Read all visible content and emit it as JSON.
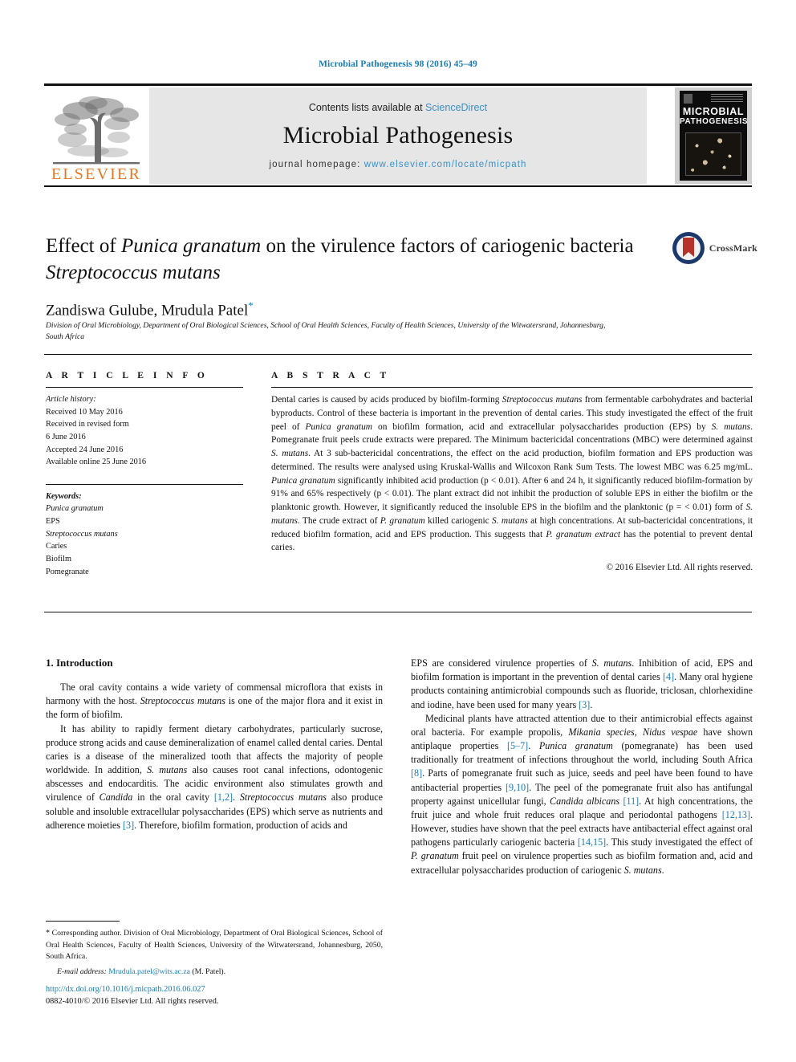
{
  "running_head": "Microbial Pathogenesis 98 (2016) 45–49",
  "masthead": {
    "publisher_name": "ELSEVIER",
    "contents_prefix": "Contents lists available at ",
    "contents_link": "ScienceDirect",
    "journal_name": "Microbial Pathogenesis",
    "homepage_prefix": "journal homepage: ",
    "homepage_url": "www.elsevier.com/locate/micpath",
    "cover_title_line1": "MICROBIAL",
    "cover_title_line2": "PATHOGENESIS"
  },
  "article": {
    "title_part1": "Effect of ",
    "title_italic1": "Punica granatum",
    "title_part2": " on the virulence factors of cariogenic bacteria ",
    "title_italic2": "Streptococcus mutans",
    "authors": "Zandiswa Gulube, Mrudula Patel",
    "corresponding_marker": "*",
    "affiliation": "Division of Oral Microbiology, Department of Oral Biological Sciences, School of Oral Health Sciences, Faculty of Health Sciences, University of the Witwatersrand, Johannesburg, South Africa",
    "crossmark_label": "CrossMark"
  },
  "article_info": {
    "heading": "A R T I C L E   I N F O",
    "history_label": "Article history:",
    "history": [
      "Received 10 May 2016",
      "Received in revised form",
      "6 June 2016",
      "Accepted 24 June 2016",
      "Available online 25 June 2016"
    ],
    "keywords_label": "Keywords:",
    "keywords": [
      "Punica granatum",
      "EPS",
      "Streptococcus mutans",
      "Caries",
      "Biofilm",
      "Pomegranate"
    ]
  },
  "abstract": {
    "heading": "A B S T R A C T",
    "text_segments": [
      {
        "t": "Dental caries is caused by acids produced by biofilm-forming "
      },
      {
        "t": "Streptococcus mutans",
        "i": true
      },
      {
        "t": " from fermentable carbohydrates and bacterial byproducts. Control of these bacteria is important in the prevention of dental caries. This study investigated the effect of the fruit peel of "
      },
      {
        "t": "Punica granatum",
        "i": true
      },
      {
        "t": " on biofilm formation, acid and extracellular polysaccharides production (EPS) by "
      },
      {
        "t": "S. mutans",
        "i": true
      },
      {
        "t": ". Pomegranate fruit peels crude extracts were prepared. The Minimum bactericidal concentrations (MBC) were determined against "
      },
      {
        "t": "S. mutans",
        "i": true
      },
      {
        "t": ". At 3 sub-bactericidal concentrations, the effect on the acid production, biofilm formation and EPS production was determined. The results were analysed using Kruskal-Wallis and Wilcoxon Rank Sum Tests. The lowest MBC was 6.25 mg/mL. "
      },
      {
        "t": "Punica granatum",
        "i": true
      },
      {
        "t": " significantly inhibited acid production (p < 0.01). After 6 and 24 h, it significantly reduced biofilm-formation by 91% and 65% respectively (p < 0.01). The plant extract did not inhibit the production of soluble EPS in either the biofilm or the planktonic growth. However, it significantly reduced the insoluble EPS in the biofilm and the planktonic (p = < 0.01) form of "
      },
      {
        "t": "S. mutans",
        "i": true
      },
      {
        "t": ". The crude extract of "
      },
      {
        "t": "P. granatum",
        "i": true
      },
      {
        "t": " killed cariogenic "
      },
      {
        "t": "S. mutans",
        "i": true
      },
      {
        "t": " at high concentrations. At sub-bactericidal concentrations, it reduced biofilm formation, acid and EPS production. This suggests that "
      },
      {
        "t": "P. granatum extract",
        "i": true
      },
      {
        "t": " has the potential to prevent dental caries."
      }
    ],
    "copyright": "© 2016 Elsevier Ltd. All rights reserved."
  },
  "introduction": {
    "heading": "1. Introduction",
    "left_paragraphs": [
      [
        {
          "t": "The oral cavity contains a wide variety of commensal microflora that exists in harmony with the host. "
        },
        {
          "t": "Streptococcus mutans",
          "i": true
        },
        {
          "t": " is one of the major flora and it exist in the form of biofilm."
        }
      ],
      [
        {
          "t": "It has ability to rapidly ferment dietary carbohydrates, particularly sucrose, produce strong acids and cause demineralization of enamel called dental caries. Dental caries is a disease of the mineralized tooth that affects the majority of people worldwide. In addition, "
        },
        {
          "t": "S. mutans",
          "i": true
        },
        {
          "t": " also causes root canal infections, odontogenic abscesses and endocarditis. The acidic environment also stimulates growth and virulence of "
        },
        {
          "t": "Candida",
          "i": true
        },
        {
          "t": " in the oral cavity "
        },
        {
          "t": "[1,2]",
          "c": true
        },
        {
          "t": ". "
        },
        {
          "t": "Streptococcus mutans",
          "i": true
        },
        {
          "t": " also produce soluble and insoluble extracellular polysaccharides (EPS) which serve as nutrients and adherence moieties "
        },
        {
          "t": "[3]",
          "c": true
        },
        {
          "t": ". Therefore, biofilm formation, production of acids and"
        }
      ]
    ],
    "right_paragraphs": [
      [
        {
          "t": "EPS are considered virulence properties of "
        },
        {
          "t": "S. mutans",
          "i": true
        },
        {
          "t": ". Inhibition of acid, EPS and biofilm formation is important in the prevention of dental caries "
        },
        {
          "t": "[4]",
          "c": true
        },
        {
          "t": ". Many oral hygiene products containing antimicrobial compounds such as fluoride, triclosan, chlorhexidine and iodine, have been used for many years "
        },
        {
          "t": "[3]",
          "c": true
        },
        {
          "t": "."
        }
      ],
      [
        {
          "t": "Medicinal plants have attracted attention due to their antimicrobial effects against oral bacteria. For example propolis, "
        },
        {
          "t": "Mikania",
          "i": true
        },
        {
          "t": " "
        },
        {
          "t": "species",
          "i": true
        },
        {
          "t": ", "
        },
        {
          "t": "Nidus vespae",
          "i": true
        },
        {
          "t": " have shown antiplaque properties "
        },
        {
          "t": "[5–7]",
          "c": true
        },
        {
          "t": ". "
        },
        {
          "t": "Punica granatum",
          "i": true
        },
        {
          "t": " (pomegranate) has been used traditionally for treatment of infections throughout the world, including South Africa "
        },
        {
          "t": "[8]",
          "c": true
        },
        {
          "t": ". Parts of pomegranate fruit such as juice, seeds and peel have been found to have antibacterial properties "
        },
        {
          "t": "[9,10]",
          "c": true
        },
        {
          "t": ". The peel of the pomegranate fruit also has antifungal property against unicellular fungi, "
        },
        {
          "t": "Candida albicans",
          "i": true
        },
        {
          "t": " "
        },
        {
          "t": "[11]",
          "c": true
        },
        {
          "t": ". At high concentrations, the fruit juice and whole fruit reduces oral plaque and periodontal pathogens "
        },
        {
          "t": "[12,13]",
          "c": true
        },
        {
          "t": ". However, studies have shown that the peel extracts have antibacterial effect against oral pathogens particularly cariogenic bacteria "
        },
        {
          "t": "[14,15]",
          "c": true
        },
        {
          "t": ". This study investigated the effect of "
        },
        {
          "t": "P. granatum",
          "i": true
        },
        {
          "t": " fruit peel on virulence properties such as biofilm formation and, acid and extracellular polysaccharides production of cariogenic "
        },
        {
          "t": "S. mutans",
          "i": true
        },
        {
          "t": "."
        }
      ]
    ]
  },
  "footnote": {
    "marker": "*",
    "text": " Corresponding author. Division of Oral Microbiology, Department of Oral Biological Sciences, School of Oral Health Sciences, Faculty of Health Sciences, University of the Witwatersrand, Johannesburg, 2050, South Africa.",
    "email_label": "E-mail address:",
    "email": "Mrudula.patel@wits.ac.za",
    "email_suffix": " (M. Patel)."
  },
  "footer": {
    "doi": "http://dx.doi.org/10.1016/j.micpath.2016.06.027",
    "issn_line": "0882-4010/© 2016 Elsevier Ltd. All rights reserved."
  },
  "colors": {
    "link": "#1a7cb5",
    "elsevier_orange": "#E87722",
    "sciencedirect_blue": "#3a8fc4"
  }
}
